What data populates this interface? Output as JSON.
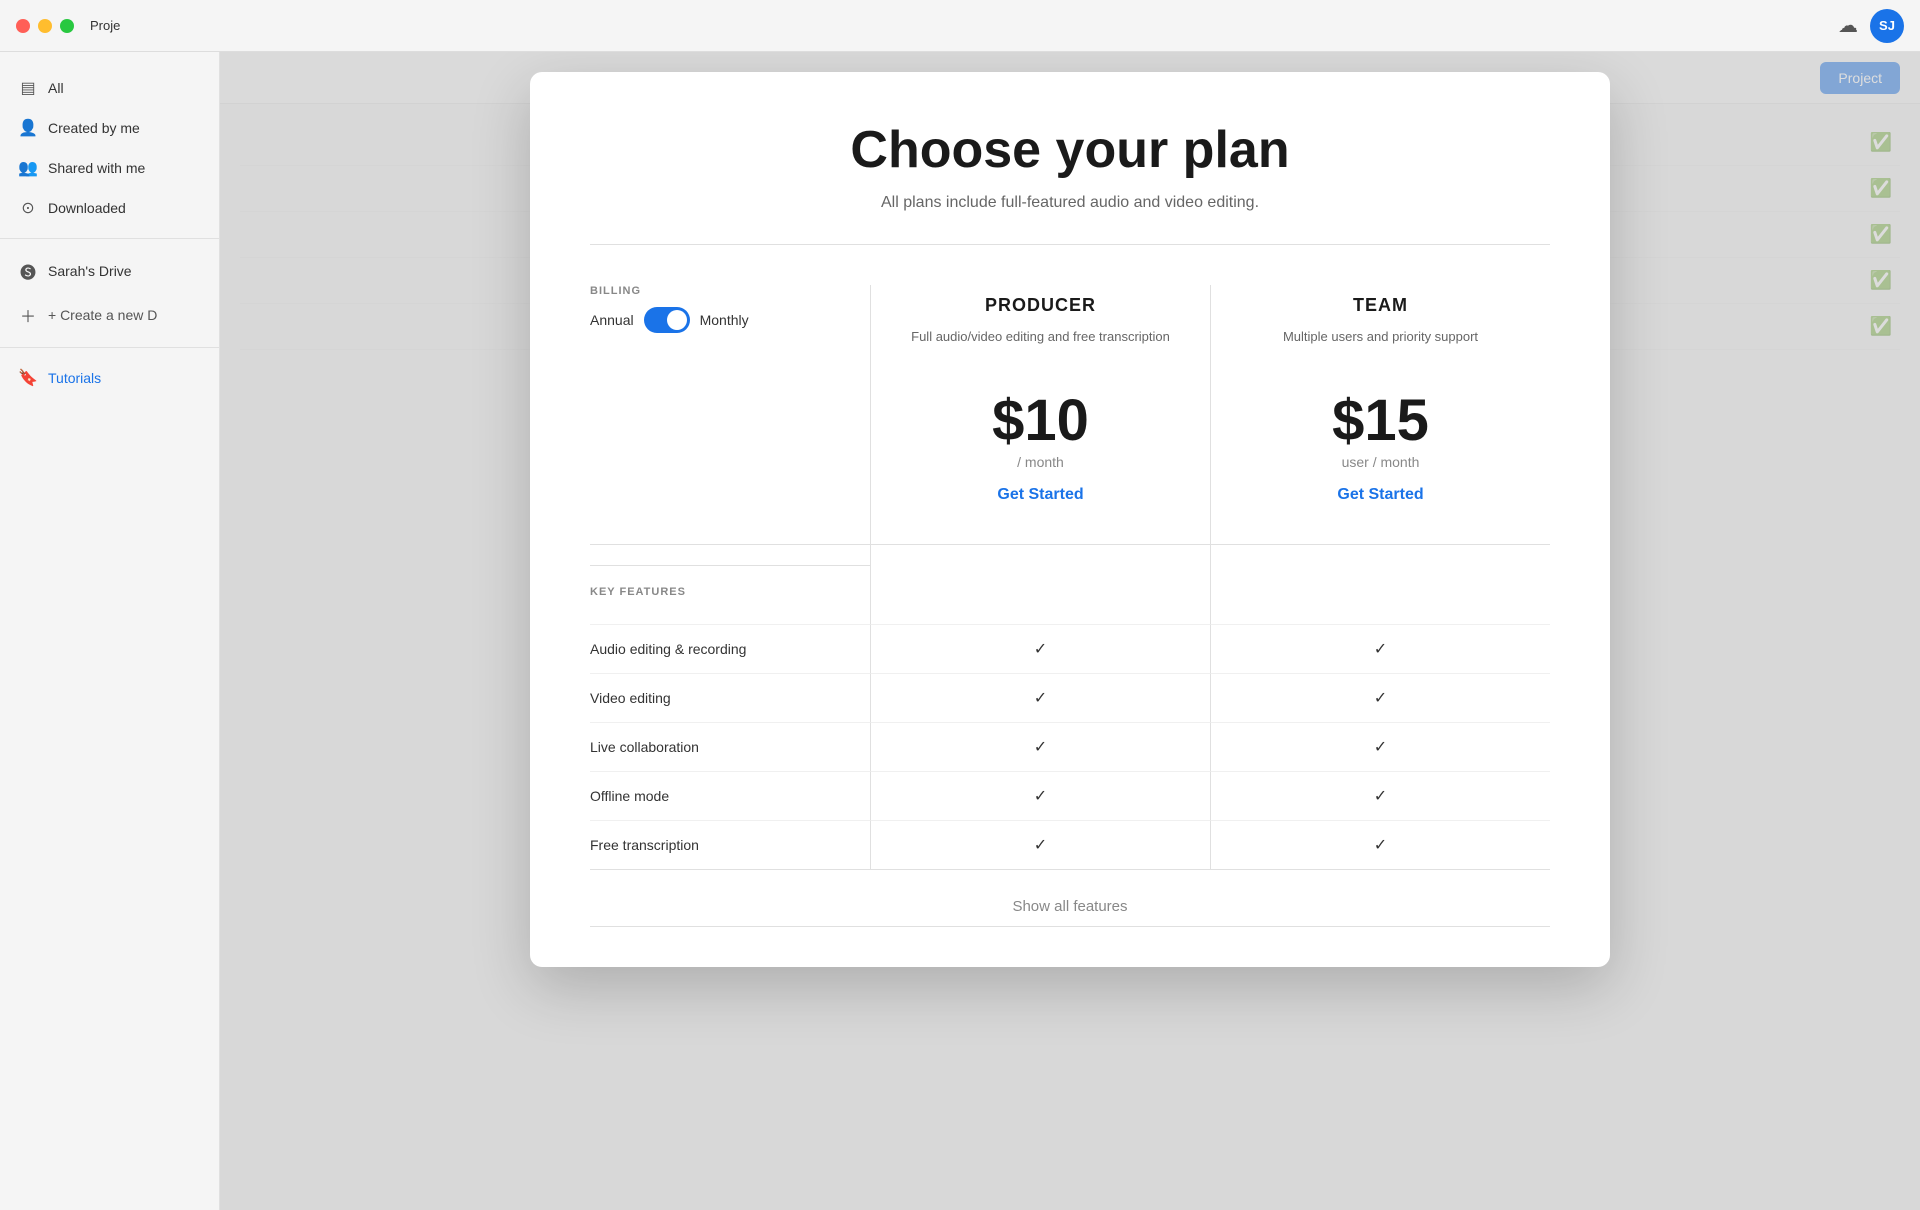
{
  "titlebar": {
    "app_name": "Proje",
    "avatar_initials": "SJ",
    "avatar_bg": "#1a73e8"
  },
  "sidebar": {
    "items": [
      {
        "id": "all",
        "label": "All",
        "icon": "▤",
        "active": false
      },
      {
        "id": "created-by-me",
        "label": "Created by me",
        "icon": "👤",
        "active": false
      },
      {
        "id": "shared-with",
        "label": "Shared with me",
        "icon": "👥",
        "active": false
      },
      {
        "id": "downloaded",
        "label": "Downloaded",
        "icon": "⊙",
        "active": false
      }
    ],
    "drive_label": "Sarah's Drive",
    "create_new_label": "+ Create a new D",
    "tutorials_label": "Tutorials"
  },
  "main": {
    "new_project_label": "Project"
  },
  "modal": {
    "title": "Choose your plan",
    "subtitle": "All plans include full-featured audio and video editing.",
    "billing": {
      "label": "BILLING",
      "annual_label": "Annual",
      "monthly_label": "Monthly",
      "is_monthly": true
    },
    "plans": [
      {
        "id": "producer",
        "name": "PRODUCER",
        "description": "Full audio/video editing and free transcription",
        "price": "$10",
        "period": "/ month",
        "cta": "Get Started"
      },
      {
        "id": "team",
        "name": "TEAM",
        "description": "Multiple users and priority support",
        "price": "$15",
        "period": "user / month",
        "cta": "Get Started"
      }
    ],
    "key_features_label": "KEY FEATURES",
    "features": [
      {
        "label": "Audio editing & recording"
      },
      {
        "label": "Video editing"
      },
      {
        "label": "Live collaboration"
      },
      {
        "label": "Offline mode"
      },
      {
        "label": "Free transcription"
      }
    ],
    "show_all_label": "Show all features"
  },
  "checkmark": "✓",
  "icons": {
    "cloud": "☁",
    "check_circle": "✅",
    "bookmark": "🔖"
  }
}
